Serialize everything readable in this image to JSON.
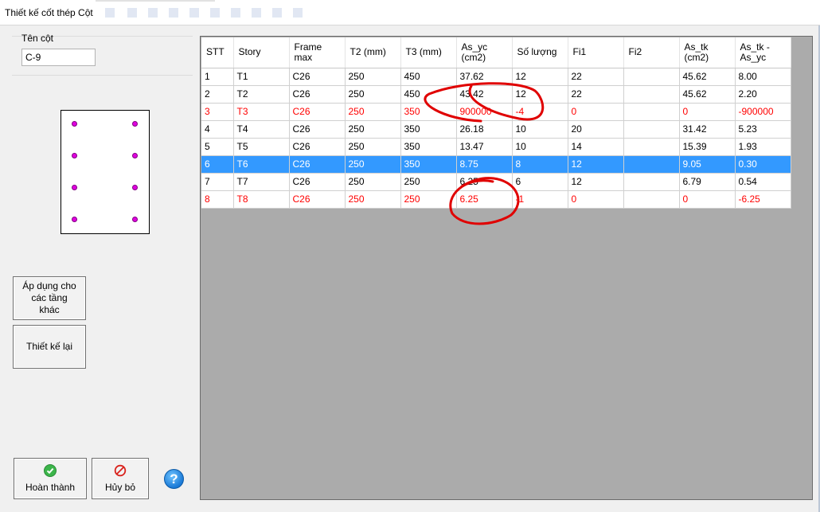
{
  "window": {
    "title": "Thiết kế cốt thép Cột"
  },
  "column_name": {
    "label": "Tên cột",
    "value": "C-9"
  },
  "buttons": {
    "apply": "Áp dụng cho các tầng khác",
    "redesign": "Thiết kế lại",
    "done": "Hoàn thành",
    "cancel": "Hủy bỏ",
    "help": "?"
  },
  "colors": {
    "error_text": "#ff0000",
    "selected_row": "#3399ff",
    "rebar": "#e000e0",
    "annotation": "#e00000"
  },
  "table": {
    "headers": [
      "STT",
      "Story",
      "Frame max",
      "T2 (mm)",
      "T3 (mm)",
      "As_yc (cm2)",
      "Số lượng",
      "Fi1",
      "Fi2",
      "As_tk (cm2)",
      "As_tk - As_yc"
    ],
    "rows": [
      {
        "state": "normal",
        "cells": [
          "1",
          "T1",
          "C26",
          "250",
          "450",
          "37.62",
          "12",
          "22",
          "",
          "45.62",
          "8.00"
        ]
      },
      {
        "state": "normal",
        "cells": [
          "2",
          "T2",
          "C26",
          "250",
          "450",
          "43.42",
          "12",
          "22",
          "",
          "45.62",
          "2.20"
        ]
      },
      {
        "state": "error",
        "cells": [
          "3",
          "T3",
          "C26",
          "250",
          "350",
          "900000",
          "-4",
          "0",
          "",
          "0",
          "-900000"
        ]
      },
      {
        "state": "normal",
        "cells": [
          "4",
          "T4",
          "C26",
          "250",
          "350",
          "26.18",
          "10",
          "20",
          "",
          "31.42",
          "5.23"
        ]
      },
      {
        "state": "normal",
        "cells": [
          "5",
          "T5",
          "C26",
          "250",
          "350",
          "13.47",
          "10",
          "14",
          "",
          "15.39",
          "1.93"
        ]
      },
      {
        "state": "selected",
        "cells": [
          "6",
          "T6",
          "C26",
          "250",
          "350",
          "8.75",
          "8",
          "12",
          "",
          "9.05",
          "0.30"
        ]
      },
      {
        "state": "normal",
        "cells": [
          "7",
          "T7",
          "C26",
          "250",
          "250",
          "6.25",
          "6",
          "12",
          "",
          "6.79",
          "0.54"
        ]
      },
      {
        "state": "error",
        "cells": [
          "8",
          "T8",
          "C26",
          "250",
          "250",
          "6.25",
          "-1",
          "0",
          "",
          "0",
          "-6.25"
        ]
      }
    ]
  }
}
